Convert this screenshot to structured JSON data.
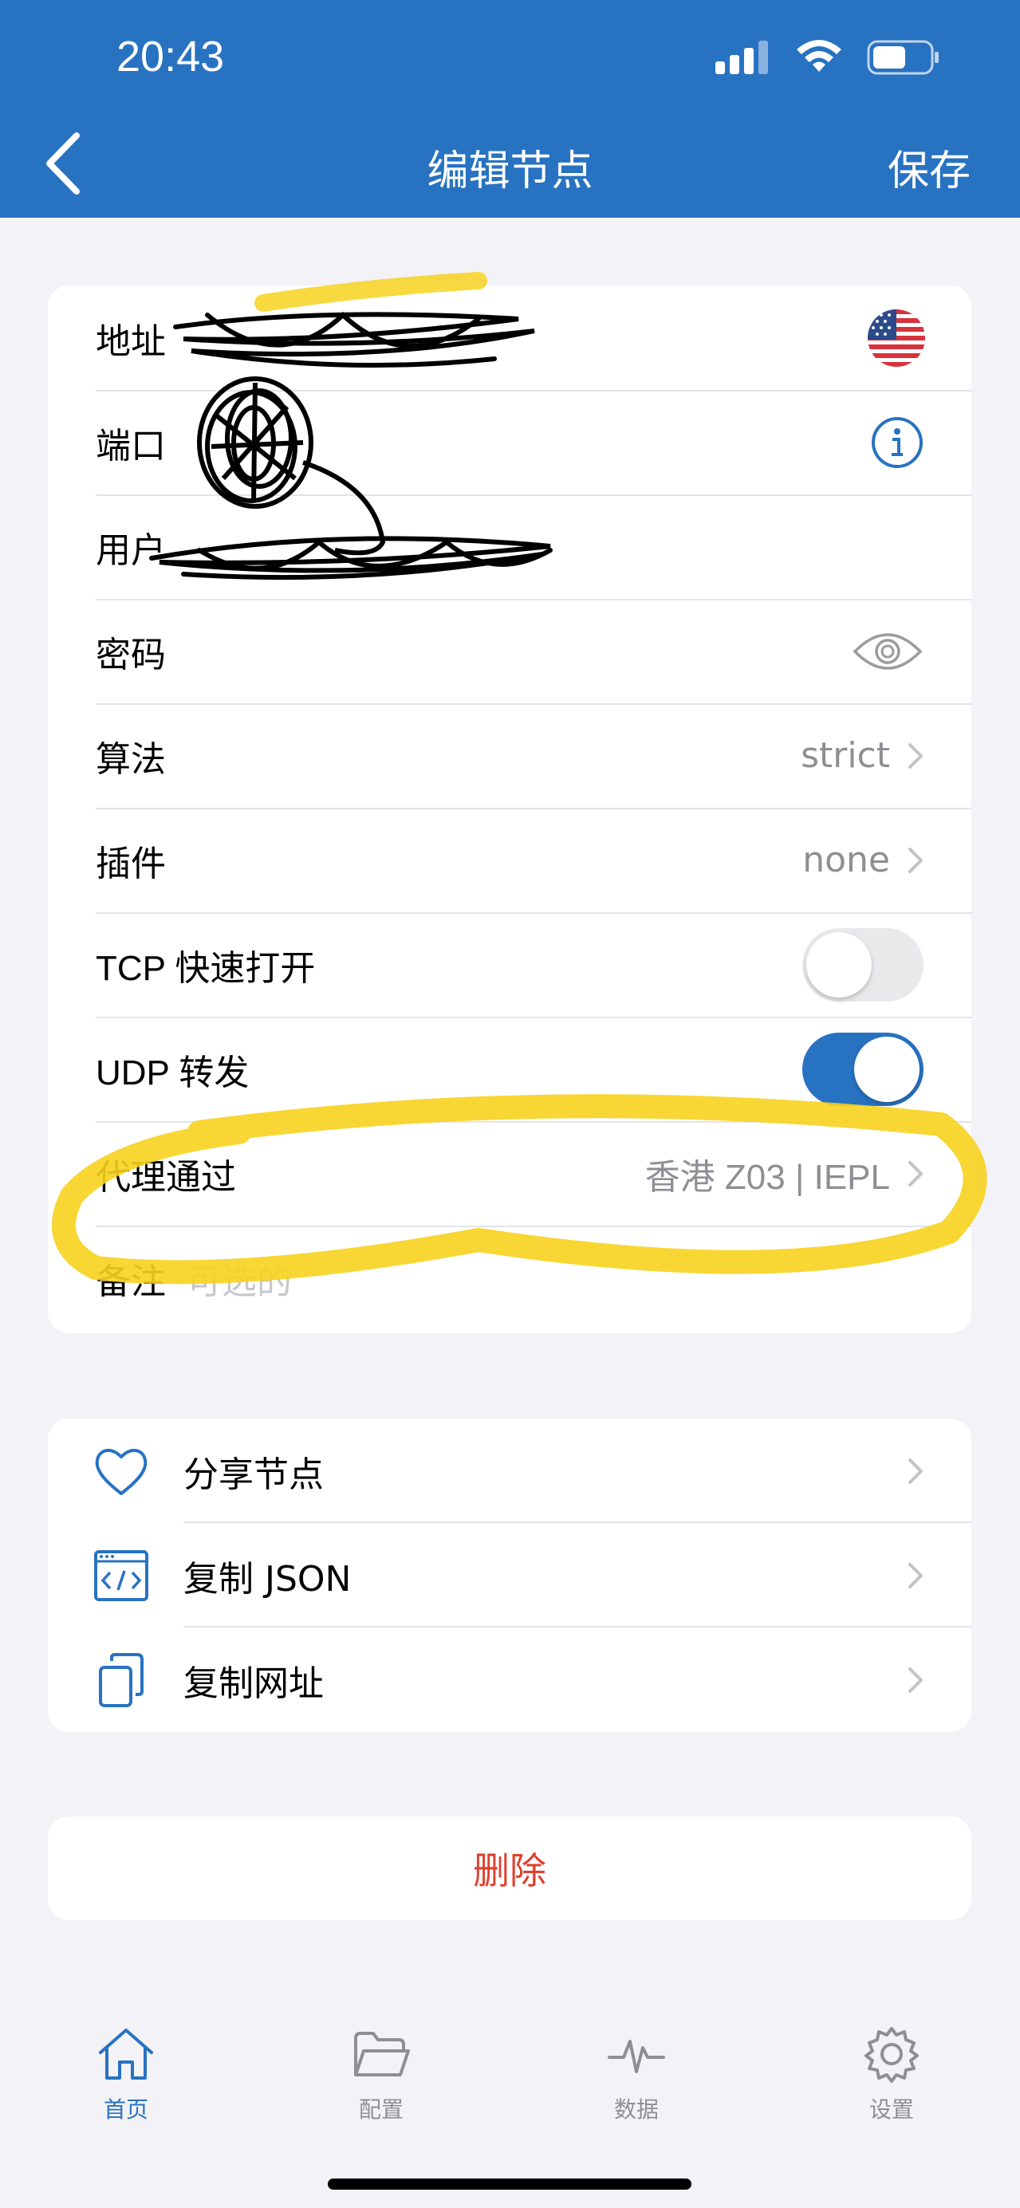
{
  "status_bar": {
    "time": "20:43"
  },
  "nav": {
    "title": "编辑节点",
    "save_label": "保存"
  },
  "form": {
    "address_label": "地址",
    "port_label": "端口",
    "user_label": "用户",
    "password_label": "密码",
    "algorithm_label": "算法",
    "algorithm_value": "strict",
    "plugin_label": "插件",
    "plugin_value": "none",
    "tcp_fast_open_label": "TCP 快速打开",
    "tcp_fast_open_enabled": false,
    "udp_relay_label": "UDP 转发",
    "udp_relay_enabled": true,
    "proxy_via_label": "代理通过",
    "proxy_via_value": "香港 Z03 | IEPL",
    "note_label": "备注",
    "note_placeholder": "可选的"
  },
  "actions": [
    {
      "label": "分享节点",
      "icon": "heart-icon"
    },
    {
      "label": "复制 JSON",
      "icon": "code-window-icon"
    },
    {
      "label": "复制网址",
      "icon": "copy-icon"
    }
  ],
  "delete_label": "删除",
  "tabs": [
    {
      "label": "首页",
      "icon": "home-icon",
      "active": true
    },
    {
      "label": "配置",
      "icon": "folder-icon",
      "active": false
    },
    {
      "label": "数据",
      "icon": "activity-icon",
      "active": false
    },
    {
      "label": "设置",
      "icon": "gear-icon",
      "active": false
    }
  ],
  "colors": {
    "brand": "#2872c2",
    "danger": "#e0402f",
    "highlight": "#f7d21e"
  }
}
